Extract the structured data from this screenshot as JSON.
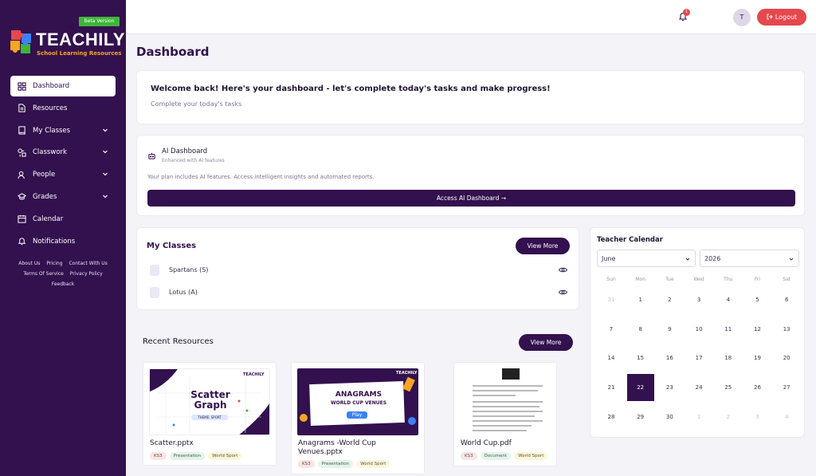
{
  "brand": {
    "name": "TEACHILY",
    "tagline": "School Learning Resources",
    "beta": "Beta Version"
  },
  "sidebar": {
    "items": [
      {
        "label": "Dashboard",
        "icon": "dashboard-icon"
      },
      {
        "label": "Resources",
        "icon": "file-icon"
      },
      {
        "label": "My Classes",
        "icon": "book-icon"
      },
      {
        "label": "Classwork",
        "icon": "shapes-icon"
      },
      {
        "label": "People",
        "icon": "user-icon"
      },
      {
        "label": "Grades",
        "icon": "graduation-cap-icon"
      },
      {
        "label": "Calendar",
        "icon": "calendar-icon"
      },
      {
        "label": "Notifications",
        "icon": "bell-icon"
      }
    ],
    "footer": [
      "About Us",
      "Pricing",
      "Contact With Us",
      "Terms Of Service",
      "Privacy Policy",
      "Feedback"
    ]
  },
  "topbar": {
    "notifications_count": "1",
    "avatar_initial": "T",
    "logout_label": "Logout"
  },
  "page": {
    "title": "Dashboard"
  },
  "welcome": {
    "heading": "Welcome back! Here's your dashboard - let's complete today's tasks and make progress!",
    "sub": "Complete your today's tasks"
  },
  "ai": {
    "title": "AI Dashboard",
    "sub": "Enhanced with AI features",
    "desc": "Your plan includes AI features. Access intelligent insights and automated reports.",
    "button": "Access AI Dashboard →"
  },
  "classes": {
    "title": "My Classes",
    "view_more": "View More",
    "items": [
      "Spartans (S)",
      "Lotus (A)"
    ]
  },
  "recent": {
    "title": "Recent Resources",
    "view_more": "View More",
    "items": [
      {
        "name": "Scatter.pptx",
        "tags": [
          "KS3",
          "Presentation",
          "World Sport"
        ],
        "thumb_title": "Scatter Graph",
        "thumb_sub": "THEME: SPORT",
        "thumb_logo": "TEACHILY"
      },
      {
        "name": "Anagrams -World Cup Venues.pptx",
        "tags": [
          "KS3",
          "Presentation",
          "World Sport"
        ],
        "thumb_title": "ANAGRAMS",
        "thumb_sub": "WORLD CUP VENUES",
        "thumb_btn": "Play",
        "thumb_logo": "TEACHILY"
      },
      {
        "name": "World Cup.pdf",
        "tags": [
          "KS3",
          "Document",
          "World Sport"
        ]
      }
    ]
  },
  "calendar": {
    "title": "Teacher Calendar",
    "month": "June",
    "year": "2026",
    "weekdays": [
      "Sun",
      "Mon",
      "Tue",
      "Wed",
      "Thu",
      "Fri",
      "Sat"
    ],
    "days": [
      [
        "31",
        "1",
        "2",
        "3",
        "4",
        "5",
        "6"
      ],
      [
        "7",
        "8",
        "9",
        "10",
        "11",
        "12",
        "13"
      ],
      [
        "14",
        "15",
        "16",
        "17",
        "18",
        "19",
        "20"
      ],
      [
        "21",
        "22",
        "23",
        "24",
        "25",
        "26",
        "27"
      ],
      [
        "28",
        "29",
        "30",
        "1",
        "2",
        "3",
        "4"
      ]
    ],
    "today": "22"
  }
}
